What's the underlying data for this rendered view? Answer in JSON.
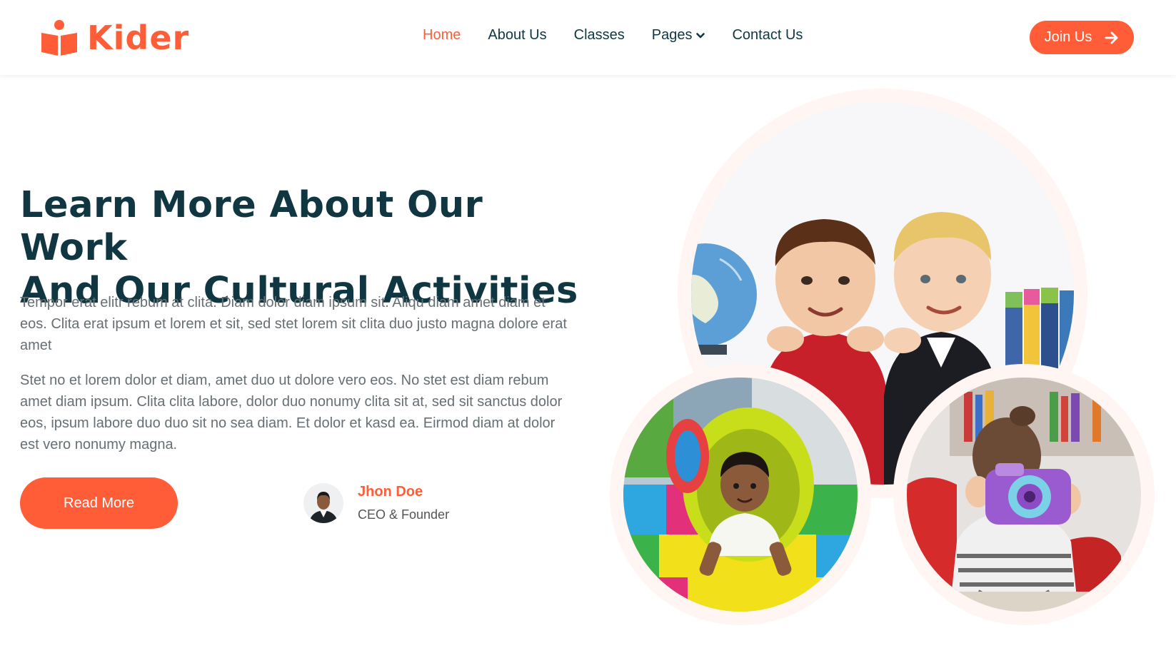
{
  "brand": {
    "name": "Kider",
    "logo_icon": "book-reader-icon",
    "color": "#FE5D37"
  },
  "nav": {
    "items": [
      {
        "label": "Home",
        "active": true
      },
      {
        "label": "About Us",
        "active": false
      },
      {
        "label": "Classes",
        "active": false
      },
      {
        "label": "Pages",
        "active": false,
        "dropdown": true
      },
      {
        "label": "Contact Us",
        "active": false
      }
    ],
    "join_label": "Join Us",
    "join_icon": "arrow-right-icon"
  },
  "hero": {
    "title_line1": "Learn More About Our Work",
    "title_line2": "And Our Cultural Activities",
    "paragraph1": "Tempor erat elitr rebum at clita. Diam dolor diam ipsum sit. Aliqu diam amet diam et eos. Clita erat ipsum et lorem et sit, sed stet lorem sit clita duo justo magna dolore erat amet",
    "paragraph2": "Stet no et lorem dolor et diam, amet duo ut dolore vero eos. No stet est diam rebum amet diam ipsum. Clita clita labore, dolor duo nonumy clita sit at, sed sit sanctus dolor eos, ipsum labore duo duo sit no sea diam. Et dolor et kasd ea. Eirmod diam at dolor est vero nonumy magna.",
    "read_more_label": "Read More"
  },
  "author": {
    "name": "Jhon Doe",
    "role": "CEO & Founder"
  },
  "colors": {
    "primary": "#FE5D37",
    "dark": "#103741",
    "text": "#666f73",
    "circle_bg": "#FFF5F3"
  }
}
